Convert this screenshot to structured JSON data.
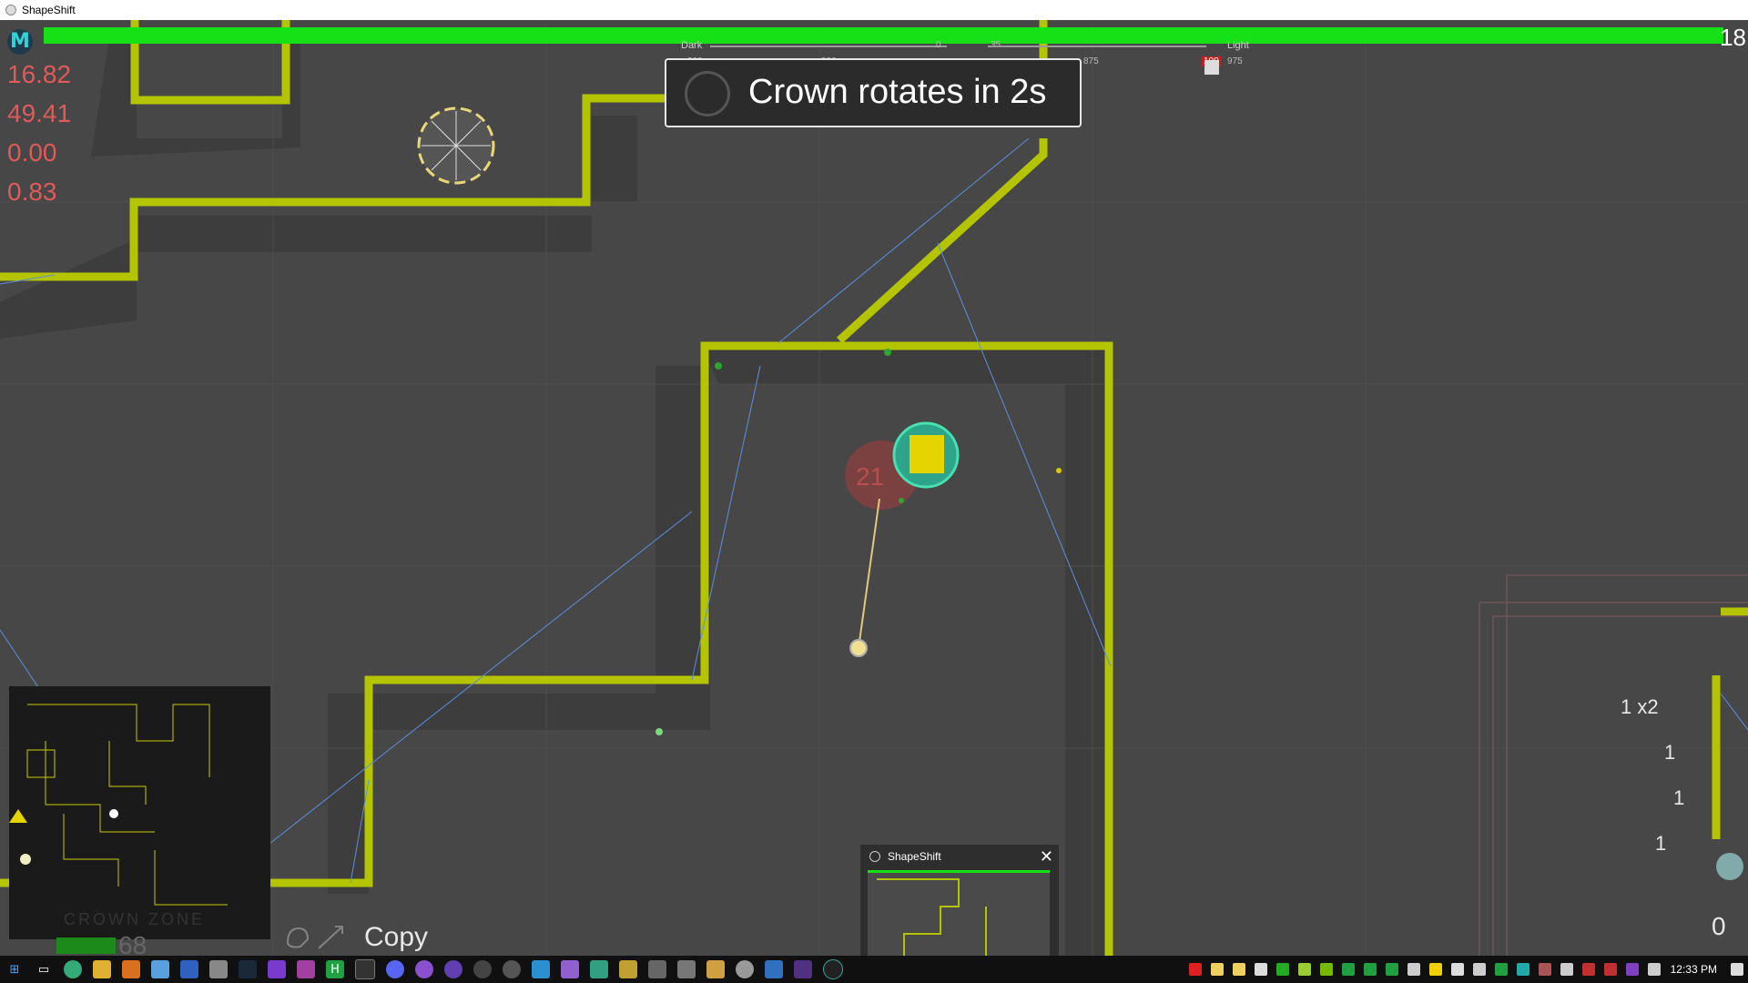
{
  "window": {
    "title": "ShapeShift"
  },
  "hud": {
    "health_value": "18",
    "stats": [
      "16.82",
      "49.41",
      "0.00",
      "0.83"
    ],
    "banner_text": "Crown rotates in 2s",
    "sliders": {
      "dark_label": "Dark",
      "light_label": "Light",
      "left_min": "900",
      "left_mid": "900",
      "left_val": "0",
      "right_val": "35",
      "right_a": "875",
      "right_b": "100",
      "right_c": "975"
    },
    "crown_zone_label": "CROWN ZONE",
    "zone_value": "68",
    "copy_label": "Copy",
    "right_values": [
      "1 x2",
      "1",
      "1",
      "1",
      "0"
    ],
    "enemy_label": "21"
  },
  "thumbnail": {
    "title": "ShapeShift"
  },
  "taskbar": {
    "icons": [
      "windows-icon",
      "task-view-icon",
      "chrome-icon",
      "file-explorer-icon",
      "media-icon",
      "notes-icon",
      "edit-icon",
      "tool-icon",
      "steam-icon",
      "visual-studio-icon",
      "vs-icon",
      "h-app-icon",
      "terminal-icon",
      "discord-icon",
      "app-icon",
      "app2-icon",
      "obs-icon",
      "obs2-icon",
      "app3-icon",
      "app4-icon",
      "app5-icon",
      "app6-icon",
      "app7-icon",
      "app8-icon",
      "app9-icon",
      "app10-icon",
      "app11-icon",
      "app12-icon",
      "app13-icon"
    ],
    "time": "12:33 PM"
  },
  "colors": {
    "wall": "#b5c400",
    "health": "#16e016",
    "stat_red": "#e05a5a",
    "laser": "#5a8fe0"
  }
}
